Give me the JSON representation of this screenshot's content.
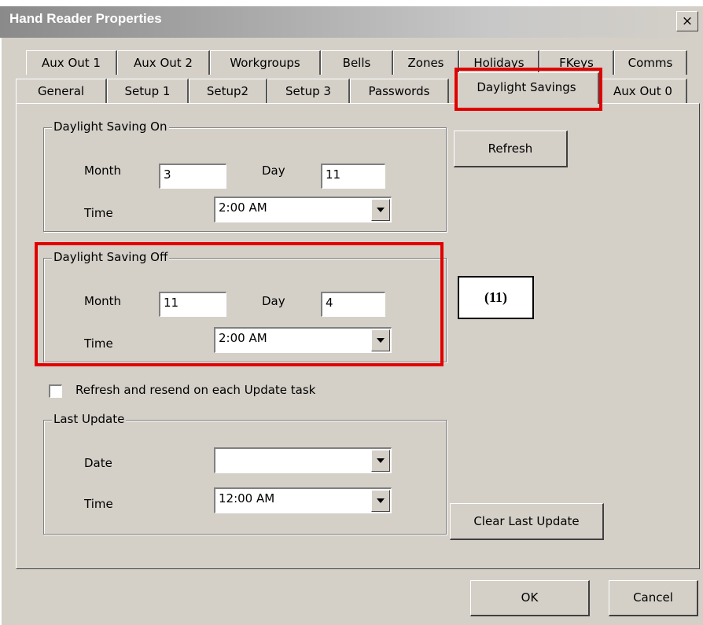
{
  "window": {
    "title": "Hand Reader Properties",
    "close_glyph": "×"
  },
  "tabs": {
    "row1": [
      "Aux Out 1",
      "Aux Out 2",
      "Workgroups",
      "Bells",
      "Zones",
      "Holidays",
      "FKeys",
      "Comms"
    ],
    "row2": [
      "General",
      "Setup 1",
      "Setup2",
      "Setup 3",
      "Passwords",
      "Daylight Savings",
      "Aux Out 0"
    ],
    "selected": "Daylight Savings"
  },
  "dst_on": {
    "legend": "Daylight Saving On",
    "month_label": "Month",
    "month": "3",
    "day_label": "Day",
    "day": "11",
    "time_label": "Time",
    "time": "2:00 AM"
  },
  "dst_off": {
    "legend": "Daylight Saving Off",
    "month_label": "Month",
    "month": "11",
    "day_label": "Day",
    "day": "4",
    "time_label": "Time",
    "time": "2:00 AM"
  },
  "refresh_button": "Refresh",
  "callout": "(11)",
  "resend_checkbox": {
    "label": "Refresh and resend on each Update task",
    "checked": false
  },
  "last_update": {
    "legend": "Last Update",
    "date_label": "Date",
    "date": "",
    "time_label": "Time",
    "time": "12:00 AM"
  },
  "clear_button": "Clear Last Update",
  "ok_button": "OK",
  "cancel_button": "Cancel",
  "colors": {
    "dialog_bg": "#d4d0c8",
    "highlight_red": "#e10000"
  }
}
